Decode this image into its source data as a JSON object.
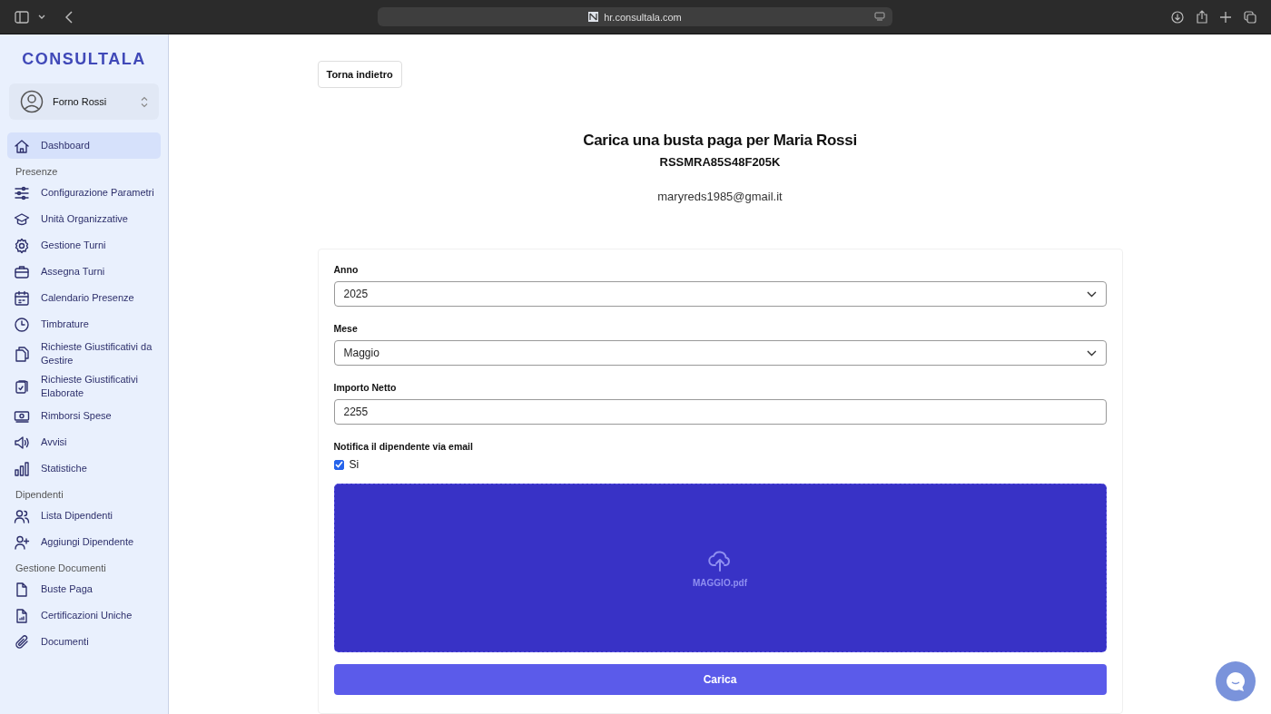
{
  "browser": {
    "url": "hr.consultala.com"
  },
  "sidebar": {
    "logo": "CONSULTALA",
    "account": {
      "name": "Forno Rossi"
    },
    "sections": [
      {
        "items": [
          {
            "label": "Dashboard",
            "selected": true
          }
        ]
      },
      {
        "header": "Presenze",
        "items": [
          {
            "label": "Configurazione Parametri",
            "selected": false
          },
          {
            "label": "Unità Organizzative",
            "selected": false
          },
          {
            "label": "Gestione Turni",
            "selected": false
          },
          {
            "label": "Assegna Turni",
            "selected": false
          },
          {
            "label": "Calendario Presenze",
            "selected": false
          },
          {
            "label": "Timbrature",
            "selected": false
          },
          {
            "label": "Richieste Giustificativi da Gestire",
            "selected": false
          },
          {
            "label": "Richieste Giustificativi Elaborate",
            "selected": false
          },
          {
            "label": "Rimborsi Spese",
            "selected": false
          },
          {
            "label": "Avvisi",
            "selected": false
          },
          {
            "label": "Statistiche",
            "selected": false
          }
        ]
      },
      {
        "header": "Dipendenti",
        "items": [
          {
            "label": "Lista Dipendenti",
            "selected": false
          },
          {
            "label": "Aggiungi Dipendente",
            "selected": false
          }
        ]
      },
      {
        "header": "Gestione Documenti",
        "items": [
          {
            "label": "Buste Paga",
            "selected": false
          },
          {
            "label": "Certificazioni Uniche",
            "selected": false
          },
          {
            "label": "Documenti",
            "selected": false
          }
        ]
      }
    ]
  },
  "page": {
    "back_button": "Torna indietro",
    "title": "Carica una busta paga per Maria Rossi",
    "tax_code": "RSSMRA85S48F205K",
    "email": "maryreds1985@gmail.it"
  },
  "form": {
    "fields": [
      {
        "kind": "select",
        "label": "Anno",
        "value": "2025"
      },
      {
        "kind": "select",
        "label": "Mese",
        "value": "Maggio"
      },
      {
        "kind": "text",
        "label": "Importo Netto",
        "value": "2255"
      }
    ],
    "notify": {
      "label": "Notifica il dipendente via email",
      "option": "Si",
      "checked": true
    },
    "upload": {
      "file": "MAGGIO.pdf"
    },
    "submit": "Carica"
  }
}
